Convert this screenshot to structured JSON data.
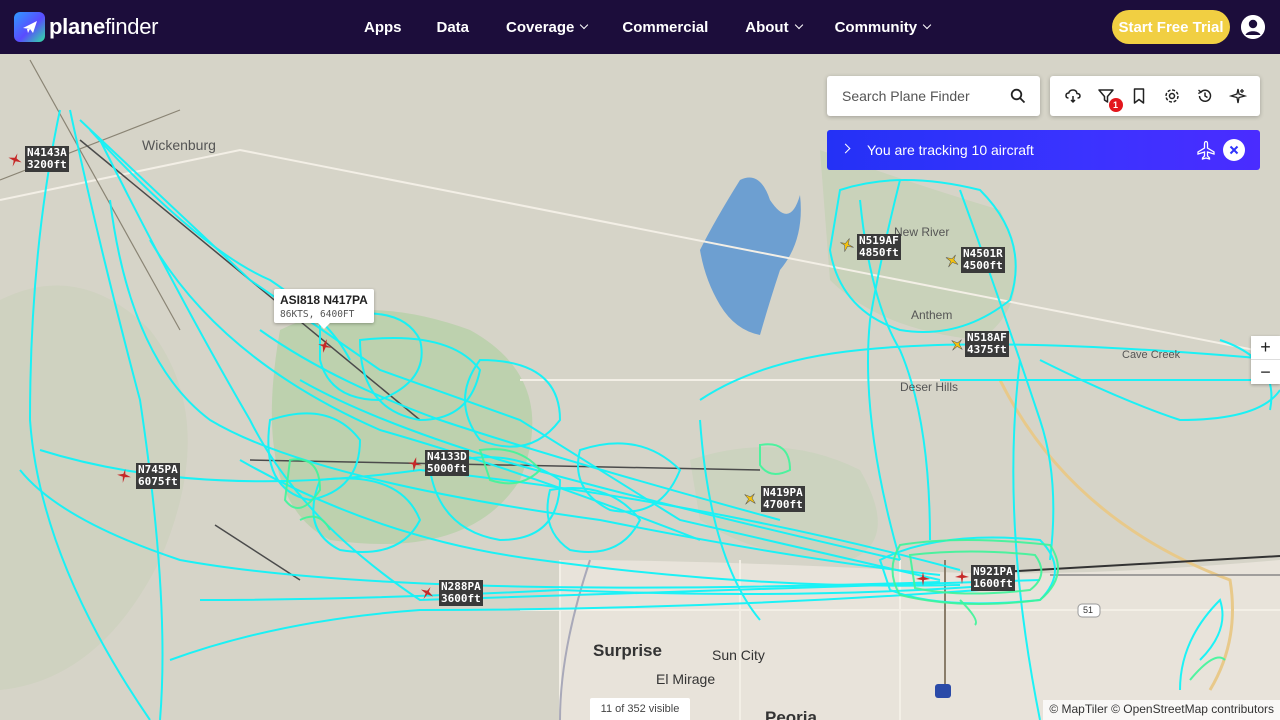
{
  "brand": {
    "name_bold": "plane",
    "name_thin": "finder"
  },
  "nav": {
    "items": [
      {
        "label": "Apps"
      },
      {
        "label": "Data"
      },
      {
        "label": "Coverage"
      },
      {
        "label": "Commercial"
      },
      {
        "label": "About"
      },
      {
        "label": "Community"
      }
    ],
    "trial_label": "Start Free Trial"
  },
  "search": {
    "placeholder": "Search Plane Finder"
  },
  "toolbar": {
    "filter_badge": "1"
  },
  "tracking": {
    "text": "You are tracking 10 aircraft"
  },
  "popup": {
    "flight": "ASI818 N417PA",
    "details": "86KTS, 6400FT"
  },
  "aircraft": [
    {
      "reg": "N4143A",
      "alt": "3200ft"
    },
    {
      "reg": "N519AF",
      "alt": "4850ft"
    },
    {
      "reg": "N4501R",
      "alt": "4500ft"
    },
    {
      "reg": "N518AF",
      "alt": "4375ft"
    },
    {
      "reg": "N745PA",
      "alt": "6075ft"
    },
    {
      "reg": "N4133D",
      "alt": "5000ft"
    },
    {
      "reg": "N419PA",
      "alt": "4700ft"
    },
    {
      "reg": "N921PA",
      "alt": "1600ft"
    },
    {
      "reg": "N288PA",
      "alt": "3600ft"
    }
  ],
  "places": {
    "wickenburg": "Wickenburg",
    "new_river": "New River",
    "anthem": "Anthem",
    "desert_hills": "Deser Hills",
    "cave_creek": "Cave Creek",
    "surprise": "Surprise",
    "sun_city": "Sun City",
    "el_mirage": "El Mirage",
    "peoria": "Peoria",
    "route_51": "51"
  },
  "zoom": {
    "in": "+",
    "out": "−"
  },
  "status": {
    "visible": "11 of 352 visible"
  },
  "attribution": "© MapTiler © OpenStreetMap contributors",
  "colors": {
    "nav_bg": "#1c0d3b",
    "trial": "#f1cf42",
    "track": "#11f3f8",
    "track_low": "#3ef59a",
    "tracking_bar": "#2f33fb"
  }
}
